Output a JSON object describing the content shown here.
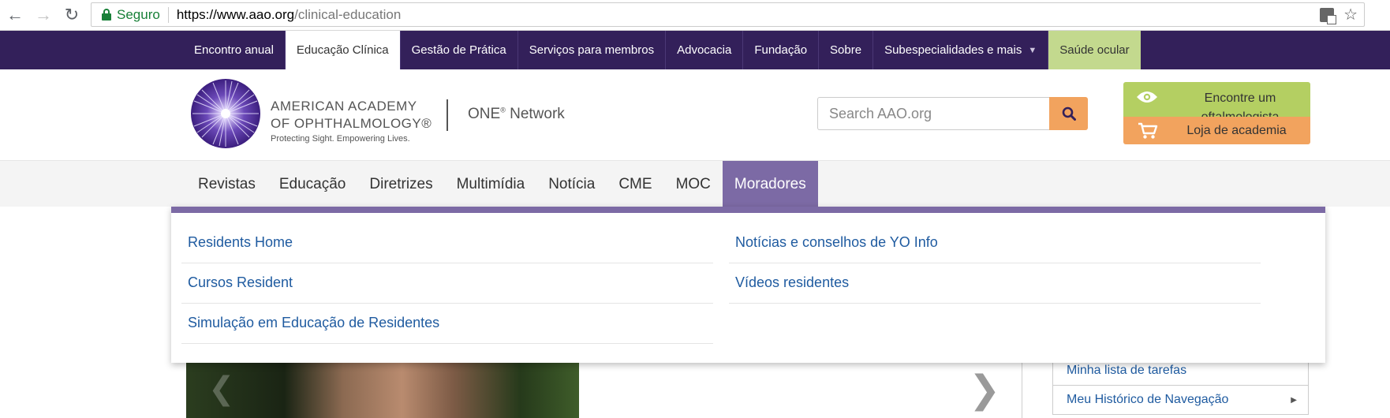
{
  "browser": {
    "secure_label": "Seguro",
    "url_scheme_host": "https://www.aao.org",
    "url_path": "/clinical-education"
  },
  "topnav": {
    "items": [
      {
        "label": "Encontro anual"
      },
      {
        "label": "Educação Clínica"
      },
      {
        "label": "Gestão de Prática"
      },
      {
        "label": "Serviços para membros"
      },
      {
        "label": "Advocacia"
      },
      {
        "label": "Fundação"
      },
      {
        "label": "Sobre"
      },
      {
        "label": "Subespecialidades e mais"
      },
      {
        "label": "Saúde ocular"
      }
    ],
    "active_index": 1
  },
  "header": {
    "academy_line1": "AMERICAN ACADEMY",
    "academy_line2": "OF OPHTHALMOLOGY®",
    "tagline": "Protecting Sight. Empowering Lives.",
    "one": "ONE",
    "one_sup": "®",
    "network": " Network",
    "search_placeholder": "Search AAO.org",
    "find_label": "Encontre um oftalmologista",
    "shop_label": "Loja de academia",
    "colors": {
      "find": "#b4cf62",
      "shop": "#f2a35e",
      "purple": "#33205a"
    }
  },
  "subnav": {
    "items": [
      {
        "label": "Revistas"
      },
      {
        "label": "Educação"
      },
      {
        "label": "Diretrizes"
      },
      {
        "label": "Multimídia"
      },
      {
        "label": "Notícia"
      },
      {
        "label": "CME"
      },
      {
        "label": "MOC"
      },
      {
        "label": "Moradores"
      }
    ],
    "active_index": 7
  },
  "dropdown": {
    "left": [
      {
        "label": "Residents Home"
      },
      {
        "label": "Cursos Resident"
      },
      {
        "label": "Simulação em Educação de Residentes"
      }
    ],
    "right": [
      {
        "label": "Notícias e conselhos de YO Info"
      },
      {
        "label": "Vídeos residentes"
      }
    ]
  },
  "sidebar": {
    "items": [
      {
        "label": "Minha lista de tarefas"
      },
      {
        "label": "Meu Histórico de Navegação"
      }
    ]
  }
}
